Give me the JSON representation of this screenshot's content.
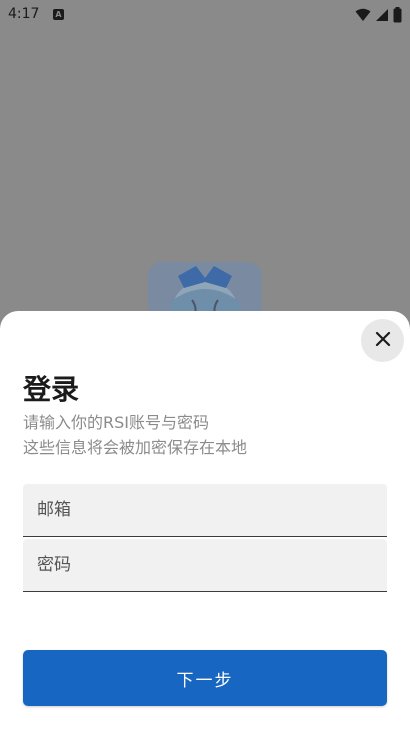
{
  "status_bar": {
    "time": "4:17",
    "app_icon_letter": "A",
    "icons": [
      "app-notification-icon",
      "wifi-icon",
      "signal-icon",
      "battery-icon"
    ]
  },
  "login": {
    "title": "登录",
    "subtitle_line1": "请输入你的RSI账号与密码",
    "subtitle_line2": "这些信息将会被加密保存在本地",
    "email_placeholder": "邮箱",
    "password_placeholder": "密码",
    "next_label": "下一步",
    "close_icon": "close-icon"
  },
  "colors": {
    "primary": "#1766c2",
    "scrim": "#8a8a8a",
    "sheet": "#ffffff",
    "field_bg": "#f1f1f1",
    "title_text": "#1b1b1b",
    "subtitle_text": "#8b8b8b"
  }
}
